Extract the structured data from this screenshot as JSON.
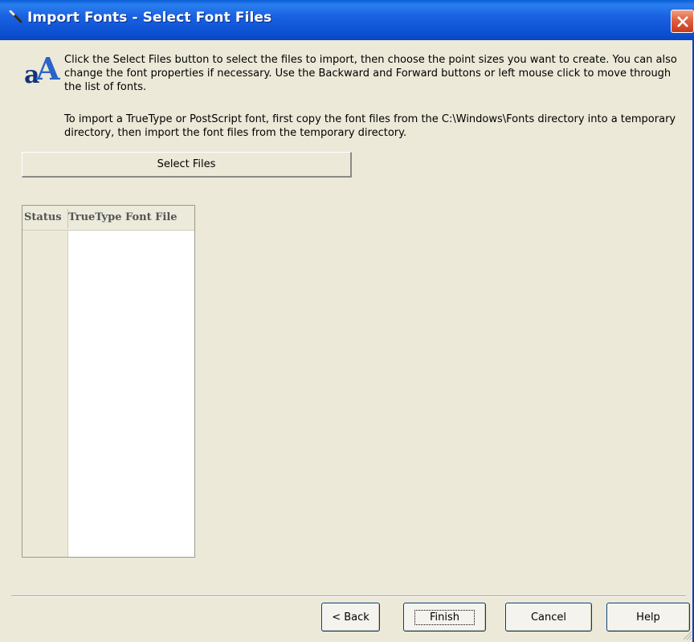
{
  "window": {
    "title": "Import Fonts - Select Font Files"
  },
  "instructions": {
    "paragraph1": "Click the Select Files button to select the files to import, then choose the point sizes you want to create. You can also change the font properties if necessary. Use the Backward and Forward buttons or left mouse click to move through the list of fonts.",
    "paragraph2": "To import a TrueType or PostScript font, first copy the font files from the C:\\Windows\\Fonts directory into a temporary directory, then import the font files from the temporary directory."
  },
  "select_files_label": "Select Files",
  "file_list": {
    "columns": [
      "Status",
      "TrueType Font File"
    ],
    "rows": []
  },
  "buttons": {
    "back": "< Back",
    "finish": "Finish",
    "cancel": "Cancel",
    "help": "Help"
  },
  "colors": {
    "title_bar": "#0a4fd0",
    "dialog_bg": "#ece9d8",
    "close_button": "#e06040"
  }
}
